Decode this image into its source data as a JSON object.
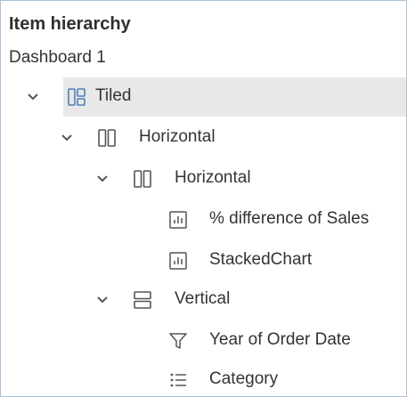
{
  "panel": {
    "title": "Item hierarchy",
    "subtitle": "Dashboard 1"
  },
  "colors": {
    "icon_blue": "#4f7fb5",
    "icon_gray": "#555555",
    "selected_bg": "#e8e8e8",
    "border": "#a9c0dd"
  },
  "tree": {
    "items": [
      {
        "label": "Tiled",
        "icon": "tiled-layout-icon",
        "expandable": true,
        "selected": true
      },
      {
        "label": "Horizontal",
        "icon": "horizontal-container-icon",
        "expandable": true
      },
      {
        "label": "Horizontal",
        "icon": "horizontal-container-icon",
        "expandable": true
      },
      {
        "label": "% difference of Sales",
        "icon": "bar-chart-sheet-icon",
        "expandable": false
      },
      {
        "label": "StackedChart",
        "icon": "bar-chart-sheet-icon",
        "expandable": false
      },
      {
        "label": "Vertical",
        "icon": "vertical-container-icon",
        "expandable": true
      },
      {
        "label": "Year of Order Date",
        "icon": "filter-icon",
        "expandable": false
      },
      {
        "label": "Category",
        "icon": "legend-list-icon",
        "expandable": false
      }
    ]
  }
}
